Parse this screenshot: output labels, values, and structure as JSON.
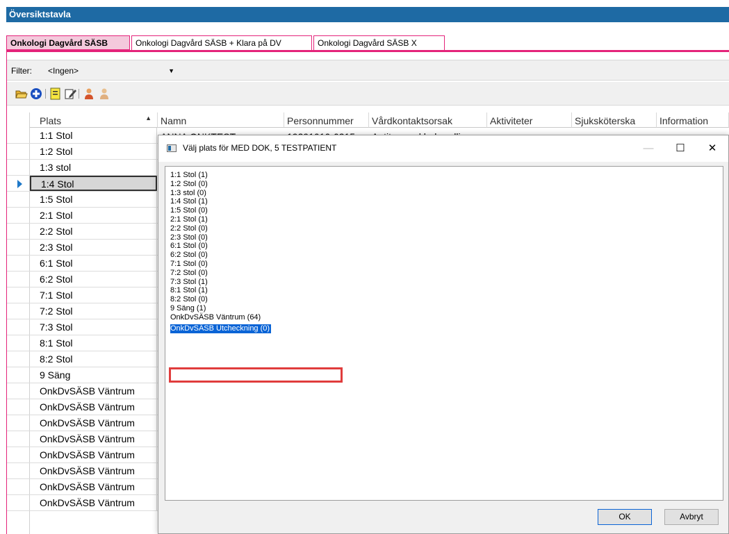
{
  "app_title": "Översiktstavla",
  "tabs": [
    {
      "label": "Onkologi Dagvård SÄSB",
      "active": true
    },
    {
      "label": "Onkologi Dagvård SÄSB + Klara på DV",
      "active": false
    },
    {
      "label": "Onkologi Dagvård SÄSB X",
      "active": false
    }
  ],
  "filter": {
    "label": "Filter:",
    "value": "<Ingen>"
  },
  "toolbar_icons": [
    "open-folder-icon",
    "add-icon",
    "note-icon",
    "edit-icon",
    "person-icon",
    "person-remove-icon"
  ],
  "grid": {
    "columns": [
      "Plats",
      "Namn",
      "Personnummer",
      "Vårdkontaktsorsak",
      "Aktiviteter",
      "Sjuksköterska",
      "Information"
    ],
    "rows": [
      "1:1 Stol",
      "1:2 Stol",
      "1:3 stol",
      "1:4 Stol",
      "1:5 Stol",
      "2:1 Stol",
      "2:2 Stol",
      "2:3 Stol",
      "6:1 Stol",
      "6:2 Stol",
      "7:1 Stol",
      "7:2 Stol",
      "7:3 Stol",
      "8:1 Stol",
      "8:2 Stol",
      "9 Säng",
      "OnkDvSÄSB Väntrum",
      "OnkDvSÄSB Väntrum",
      "OnkDvSÄSB Väntrum",
      "OnkDvSÄSB Väntrum",
      "OnkDvSÄSB Väntrum",
      "OnkDvSÄSB Väntrum",
      "OnkDvSÄSB Väntrum",
      "OnkDvSÄSB Väntrum"
    ],
    "selected_row": 3,
    "partial_row": {
      "name": "ANNA ONKTEST",
      "personnummer": "19391010-0315",
      "reason": "Antitumoral behandling"
    }
  },
  "dialog": {
    "title": "Välj plats för MED DOK, 5 TESTPATIENT",
    "minimize": "—",
    "maximize": "☐",
    "close": "✕",
    "items": [
      "1:1 Stol (1)",
      "1:2 Stol (0)",
      "1:3 stol (0)",
      "1:4 Stol (1)",
      "1:5 Stol (0)",
      "2:1 Stol (1)",
      "2:2 Stol (0)",
      "2:3 Stol (0)",
      "6:1 Stol (0)",
      "6:2 Stol (0)",
      "7:1 Stol (0)",
      "7:2 Stol (0)",
      "7:3 Stol (1)",
      "8:1 Stol (1)",
      "8:2 Stol (0)",
      "9 Säng (1)",
      "OnkDvSÄSB Väntrum (64)",
      "OnkDvSÄSB Utcheckning (0)"
    ],
    "selected_item": 17,
    "ok_label": "OK",
    "cancel_label": "Avbryt"
  },
  "colors": {
    "titlebar": "#1e6aa4",
    "accent": "#e4237a",
    "selection": "#0a64d6",
    "highlight": "#e03c3c"
  }
}
